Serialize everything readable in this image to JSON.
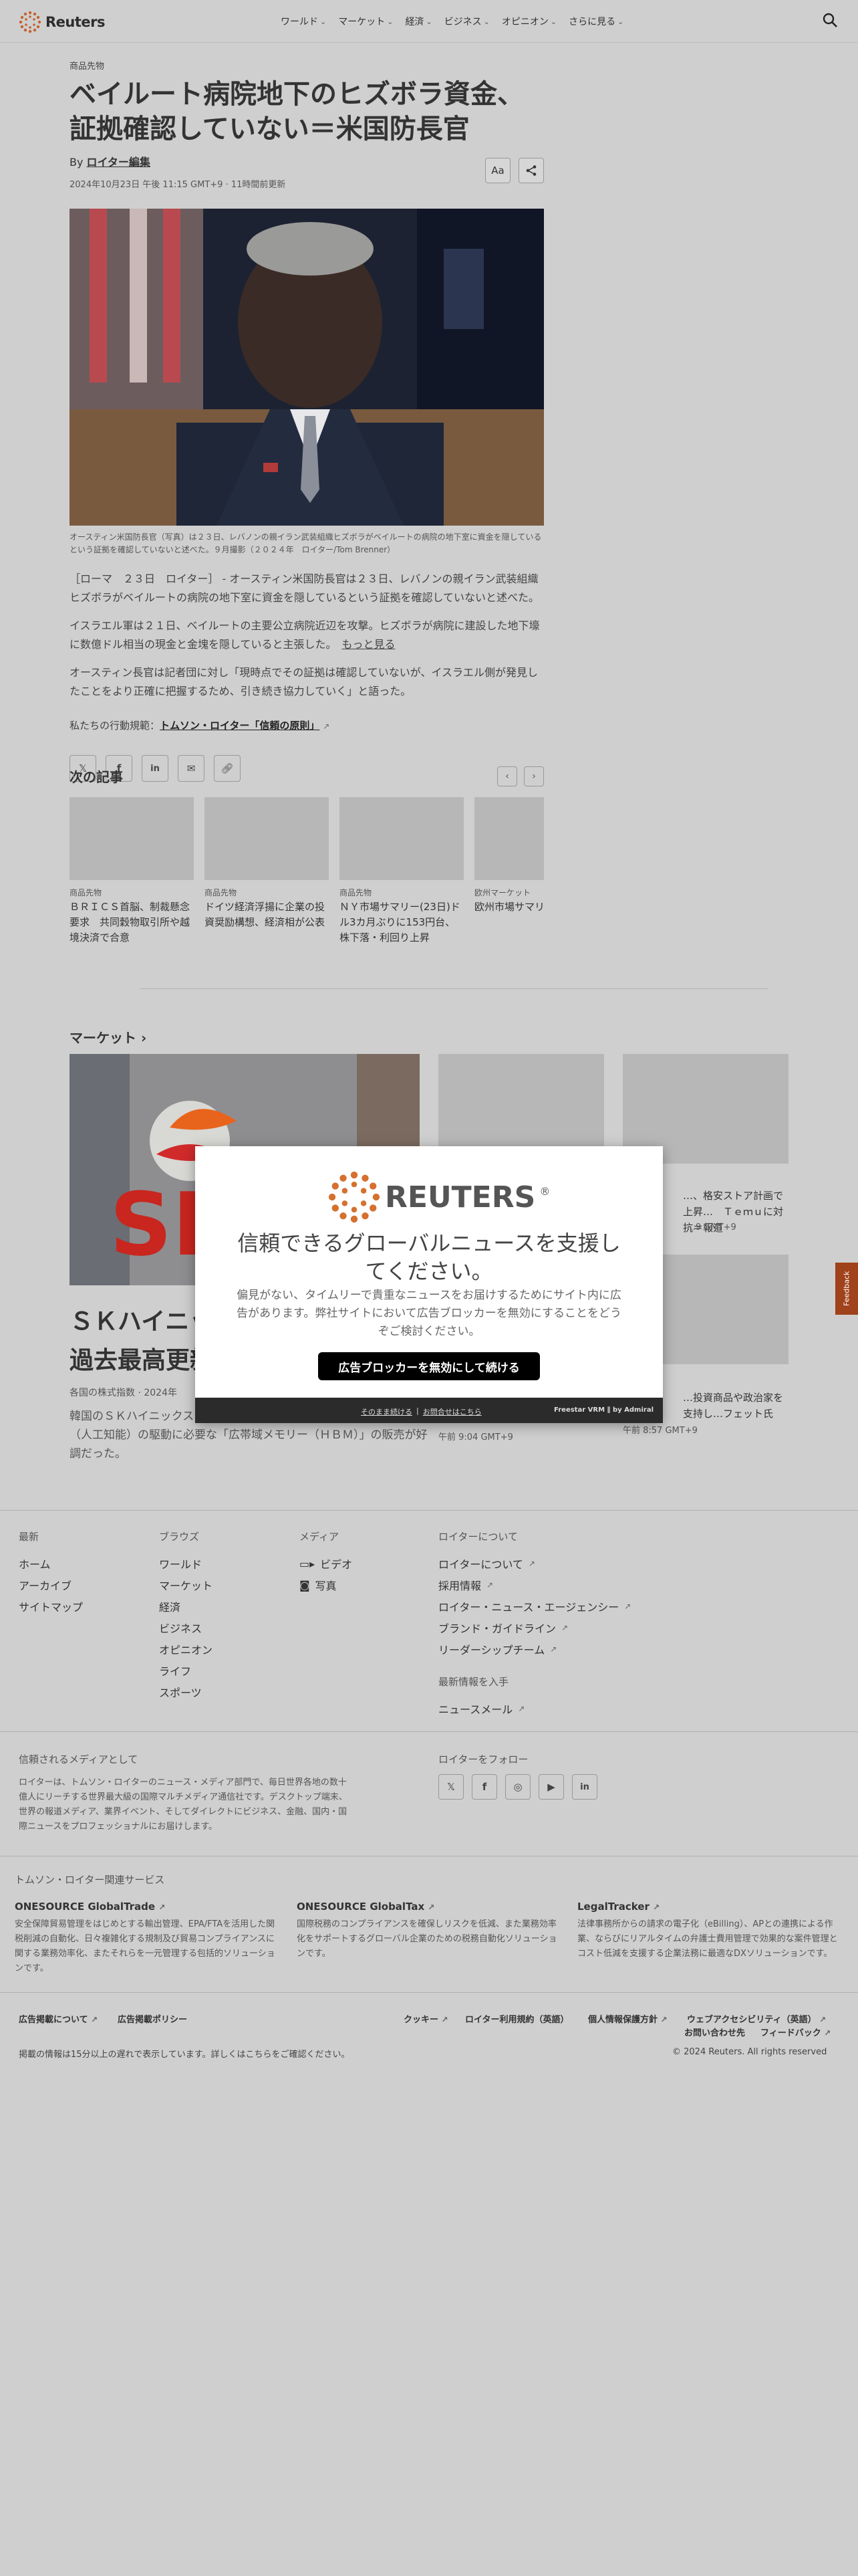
{
  "header": {
    "logo": "Reuters",
    "nav": [
      "ワールド",
      "マーケット",
      "経済",
      "ビジネス",
      "オピニオン",
      "さらに見る"
    ]
  },
  "article": {
    "section": "商品先物",
    "headline_line1": "ベイルート病院地下のヒズボラ資金、",
    "headline_line2": "証拠確認していない＝米国防長官",
    "by": "By",
    "author": "ロイター編集",
    "dateline": "2024年10月23日 午後 11:15 GMT+9 · 11時間前更新",
    "font_tool": "Aa",
    "caption": "オースティン米国防長官（写真）は２３日、レバノンの親イラン武装組織ヒズボラがベイルートの病院の地下室に資金を隠しているという証拠を確認していないと述べた。９月撮影（２０２４年　ロイター/Tom Brenner）",
    "p1": "［ローマ　２３日　ロイター］ - オースティン米国防長官は２３日、レバノンの親イラン武装組織ヒズボラがベイルートの病院の地下室に資金を隠しているという証拠を確認していないと述べた。",
    "p2": "イスラエル軍は２１日、ベイルートの主要公立病院近辺を攻撃。ヒズボラが病院に建設した地下壕に数億ドル相当の現金と金塊を隠していると主張した。",
    "p2_more": "もっと見る",
    "p3": "オースティン長官は記者団に対し「現時点でその証拠は確認していないが、イスラエル側が発見したことをより正確に把握するため、引き続き協力していく」と語った。",
    "principles_prefix": "私たちの行動規範：",
    "principles_link": "トムソン・ロイター「信頼の原則」"
  },
  "next": {
    "title": "次の記事",
    "cards": [
      {
        "kicker": "商品先物",
        "title": "ＢＲＩＣＳ首脳、制裁懸念要求　共同穀物取引所や越境決済で合意"
      },
      {
        "kicker": "商品先物",
        "title": "ドイツ経済浮揚に企業の投資奨励構想、経済相が公表"
      },
      {
        "kicker": "商品先物",
        "title": "ＮＹ市場サマリー(23日)ドル3カ月ぶりに153円台、株下落・利回り上昇"
      },
      {
        "kicker": "欧州マーケット",
        "title": "欧州市場サマリー"
      }
    ]
  },
  "markets": {
    "title": "マーケット",
    "main_title_line1": "ＳＫハイニックス",
    "main_title_line2": "過去最高更新",
    "main_meta": "各国の株式指数 · 2024年",
    "main_desc": "韓国のＳＫハイニックスは、…益が過去最高を更新した。生成ＡＩ（人工知能）の駆動に必要な「広帯域メモリー（ＨＢＭ）」の販売が好調だった。",
    "side": [
      {
        "title": "",
        "time": "午前 9:04 GMT+9"
      },
      {
        "title": "…、格安ストア計画で上昇…　Ｔｅｍｕに対抗＝報道",
        "time": "…9 GMT+9"
      },
      {
        "title": "…投資商品や政治家を支持し…フェット氏",
        "time": "午前 8:57 GMT+9"
      }
    ]
  },
  "overlay": {
    "logo": "REUTERS",
    "title": "信頼できるグローバルニュースを支援してください。",
    "text": "偏見がない、タイムリーで貴重なニュースをお届けするためにサイト内に広告があります。弊社サイトにおいて広告ブロッカーを無効にすることをどうぞご検討ください。",
    "button": "広告ブロッカーを無効にして続ける",
    "link1": "そのまま続ける",
    "sep": "|",
    "link2": "お問合せはこちら",
    "brand": "Freestar VRM ∥ by Admiral"
  },
  "feedback": "Feedback",
  "footer": {
    "col1": {
      "head": "最新",
      "items": [
        "ホーム",
        "アーカイブ",
        "サイトマップ"
      ]
    },
    "col2": {
      "head": "ブラウズ",
      "items": [
        "ワールド",
        "マーケット",
        "経済",
        "ビジネス",
        "オピニオン",
        "ライフ",
        "スポーツ"
      ]
    },
    "col3": {
      "head": "メディア",
      "items": [
        "ビデオ",
        "写真"
      ]
    },
    "col4": {
      "head": "ロイターについて",
      "items": [
        "ロイターについて",
        "採用情報",
        "ロイター・ニュース・エージェンシー",
        "ブランド・ガイドライン",
        "リーダーシップチーム"
      ]
    },
    "latest_head": "最新情報を入手",
    "newsletter": "ニュースメール",
    "trusted_head": "信頼されるメディアとして",
    "trusted_text": "ロイターは、トムソン・ロイターのニュース・メディア部門で、毎日世界各地の数十億人にリーチする世界最大級の国際マルチメディア通信社です。デスクトップ端末、世界の報道メディア、業界イベント、そしてダイレクトにビジネス、金融、国内・国際ニュースをプロフェッショナルにお届けします。",
    "follow_head": "ロイターをフォロー",
    "tr_head": "トムソン・ロイター関連サービス",
    "services": [
      {
        "name": "ONESOURCE GlobalTrade",
        "text": "安全保障貿易管理をはじめとする輸出管理、EPA/FTAを活用した関税削減の自動化、日々複雑化する規制及び貿易コンプライアンスに関する業務効率化、またそれらを一元管理する包括的ソリューションです。"
      },
      {
        "name": "ONESOURCE GlobalTax",
        "text": "国際税務のコンプライアンスを確保しリスクを低減、また業務効率化をサポートするグローバル企業のための税務自動化ソリューションです。"
      },
      {
        "name": "LegalTracker",
        "text": "法律事務所からの請求の電子化（eBilling）、APとの連携による作業、ならびにリアルタイムの弁護士費用管理で効果的な案件管理とコスト低減を支援する企業法務に最適なDXソリューションです。"
      }
    ],
    "legal": [
      "広告掲載について",
      "広告掲載ポリシー",
      "クッキー",
      "ロイター利用規約（英語）",
      "個人情報保護方針",
      "ウェブアクセシビリティ（英語）",
      "お問い合わせ先",
      "フィードバック"
    ],
    "delay": "掲載の情報は15分以上の遅れで表示しています。詳しくはこちらをご確認ください。",
    "copyright": "© 2024 Reuters. All rights reserved"
  }
}
